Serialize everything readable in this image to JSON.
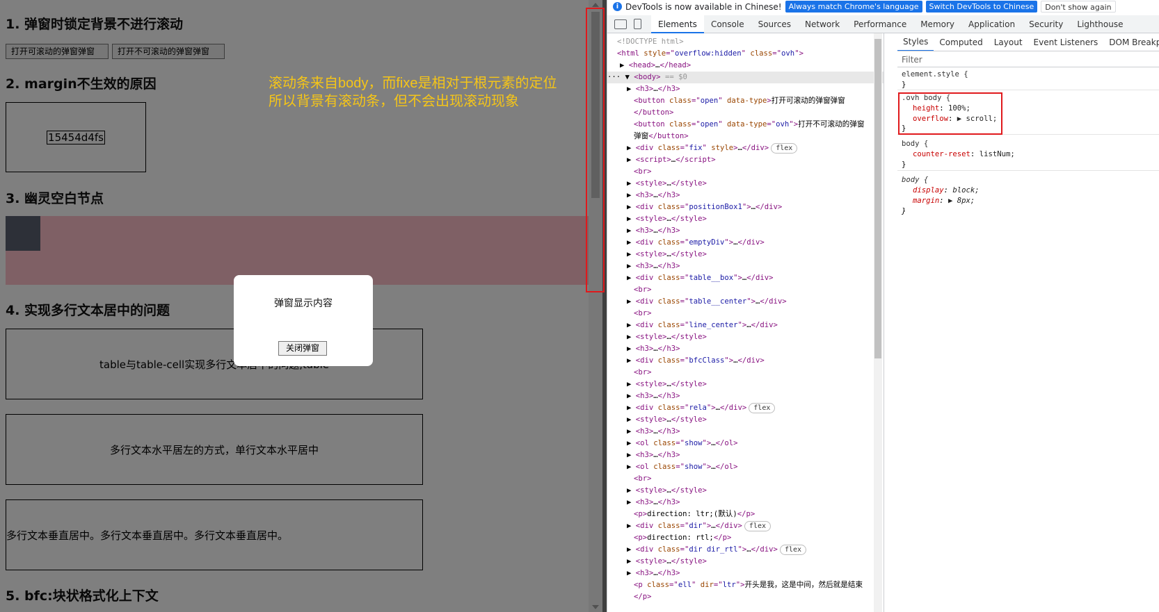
{
  "page": {
    "h1": "1. 弹窗时锁定背景不进行滚动",
    "btn_scroll": "打开可滚动的弹窗弹窗",
    "btn_noscroll": "打开不可滚动的弹窗弹窗",
    "h2": "2. margin不生效的原因",
    "box_text": "15454d4fs",
    "h3": "3. 幽灵空白节点",
    "h4": "4. 实现多行文本居中的问题",
    "box1_text": "table与table-cell实现多行文本居中的问题,table",
    "box2_text": "多行文本水平居左的方式，单行文本水平居中",
    "box3_text": "多行文本垂直居中。多行文本垂直居中。多行文本垂直居中。",
    "h5": "5. bfc:块状格式化上下文"
  },
  "modal": {
    "text": "弹窗显示内容",
    "close": "关闭弹窗"
  },
  "annotation": {
    "line1": "滚动条来自body，而fixe是相对于根元素的定位",
    "line2": "所以背景有滚动条，但不会出现滚动现象"
  },
  "devtools": {
    "info": "DevTools is now available in Chinese!",
    "btn_match": "Always match Chrome's language",
    "btn_switch": "Switch DevTools to Chinese",
    "btn_dont": "Don't show again",
    "tabs": [
      "Elements",
      "Console",
      "Sources",
      "Network",
      "Performance",
      "Memory",
      "Application",
      "Security",
      "Lighthouse"
    ],
    "sub_tabs": [
      "Styles",
      "Computed",
      "Layout",
      "Event Listeners",
      "DOM Breakpoints"
    ],
    "filter": "Filter"
  },
  "colors": {
    "accent": "#1a73e8",
    "highlight": "#e0191c",
    "annotation": "#f5c518",
    "tag": "#881280",
    "attr": "#994500",
    "val": "#1a1aa6"
  }
}
